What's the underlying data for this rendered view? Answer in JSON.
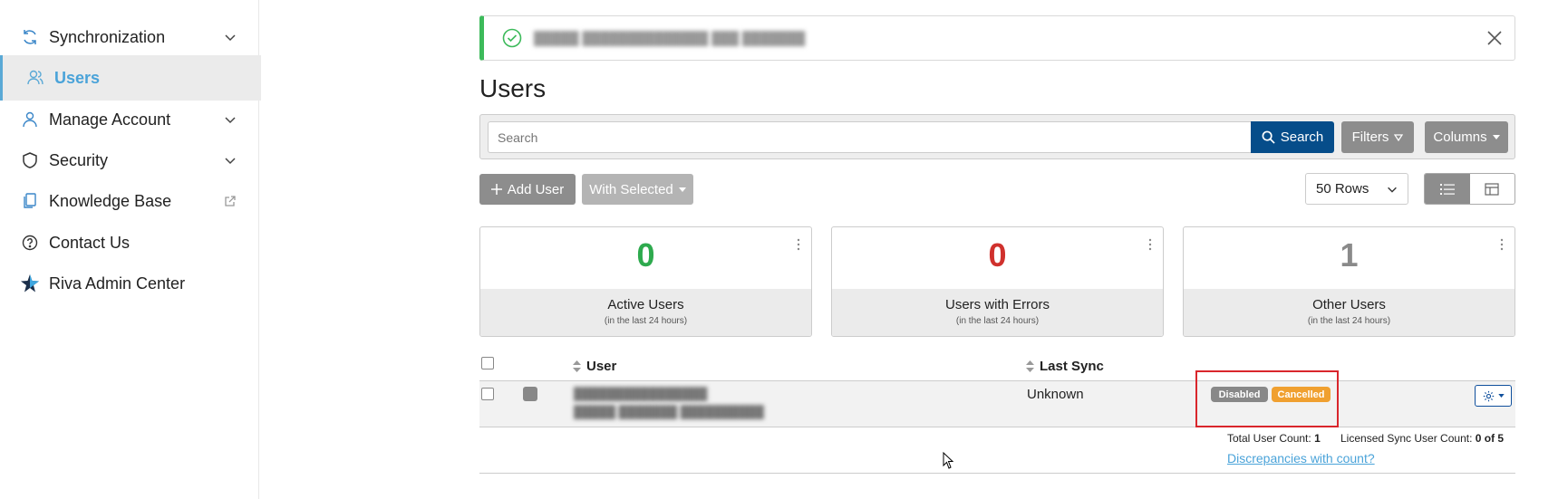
{
  "sidebar": {
    "items": [
      {
        "label": "Synchronization",
        "icon": "sync-icon",
        "has_chevron": true
      },
      {
        "label": "Users",
        "icon": "users-icon",
        "active": true
      },
      {
        "label": "Manage Account",
        "icon": "person-icon",
        "has_chevron": true
      },
      {
        "label": "Security",
        "icon": "shield-icon",
        "has_chevron": true
      },
      {
        "label": "Knowledge Base",
        "icon": "documents-icon",
        "external": true
      },
      {
        "label": "Contact Us",
        "icon": "question-circle-icon"
      },
      {
        "label": "Riva Admin Center",
        "icon": "star-icon"
      }
    ]
  },
  "banner": {
    "message": "█████ ██████████████ ███ ███████",
    "status_color": "#3cba5a"
  },
  "page": {
    "title": "Users"
  },
  "search": {
    "placeholder": "Search",
    "button_label": "Search",
    "filters_label": "Filters",
    "columns_label": "Columns"
  },
  "toolbar": {
    "add_user_label": "Add User",
    "with_selected_label": "With Selected",
    "rows_value": "50 Rows"
  },
  "cards": [
    {
      "value": "0",
      "label": "Active Users",
      "sub": "(in the last 24 hours)",
      "color": "#2eaa4e"
    },
    {
      "value": "0",
      "label": "Users with Errors",
      "sub": "(in the last 24 hours)",
      "color": "#d0312d"
    },
    {
      "value": "1",
      "label": "Other Users",
      "sub": "(in the last 24 hours)",
      "color": "#8a8a8a"
    }
  ],
  "table": {
    "headers": {
      "user": "User",
      "last_sync": "Last Sync"
    },
    "rows": [
      {
        "user_line1": "████████████████",
        "user_line2": "█████ ███████ ██████████",
        "last_sync": "Unknown",
        "badges": [
          {
            "label": "Disabled",
            "color": "#888888"
          },
          {
            "label": "Cancelled",
            "color": "#f0a030"
          }
        ]
      }
    ]
  },
  "footer": {
    "total_label": "Total User Count:",
    "total_value": "1",
    "licensed_label": "Licensed Sync User Count:",
    "licensed_value": "0 of 5",
    "discrepancies_link": "Discrepancies with count?"
  }
}
